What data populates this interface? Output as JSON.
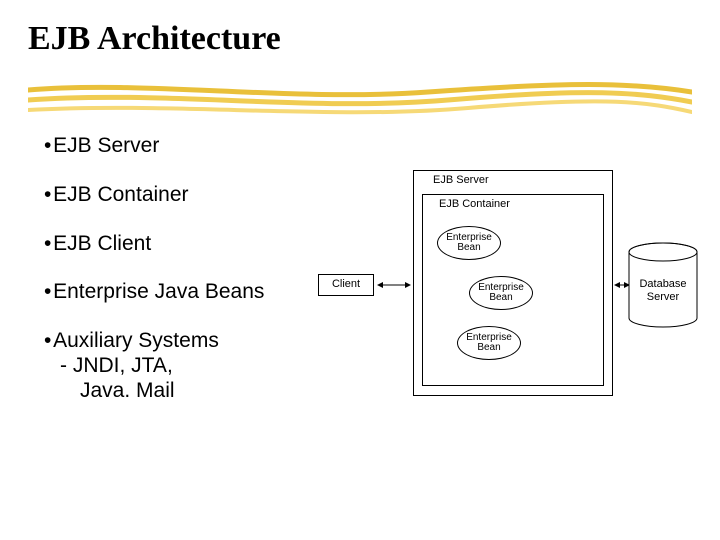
{
  "title": "EJB Architecture",
  "bullets": {
    "b1": "EJB Server",
    "b2": "EJB Container",
    "b3": "EJB Client",
    "b4": "Enterprise Java Beans",
    "b5": "Auxiliary Systems",
    "b5_sub1": "- JNDI, JTA,",
    "b5_sub2": "Java. Mail"
  },
  "diagram": {
    "server": "EJB Server",
    "container": "EJB Container",
    "bean": "Enterprise\nBean",
    "client": "Client",
    "database": "Database\nServer"
  },
  "chart_data": {
    "type": "diagram",
    "title": "EJB Architecture",
    "nodes": [
      {
        "id": "client",
        "label": "Client",
        "shape": "rect"
      },
      {
        "id": "server",
        "label": "EJB Server",
        "shape": "rect"
      },
      {
        "id": "container",
        "label": "EJB Container",
        "shape": "rect",
        "parent": "server"
      },
      {
        "id": "bean1",
        "label": "Enterprise Bean",
        "shape": "ellipse",
        "parent": "container"
      },
      {
        "id": "bean2",
        "label": "Enterprise Bean",
        "shape": "ellipse",
        "parent": "container"
      },
      {
        "id": "bean3",
        "label": "Enterprise Bean",
        "shape": "ellipse",
        "parent": "container"
      },
      {
        "id": "db",
        "label": "Database Server",
        "shape": "cylinder"
      }
    ],
    "edges": [
      {
        "from": "client",
        "to": "server",
        "bidirectional": true
      },
      {
        "from": "server",
        "to": "db",
        "bidirectional": true
      }
    ]
  }
}
